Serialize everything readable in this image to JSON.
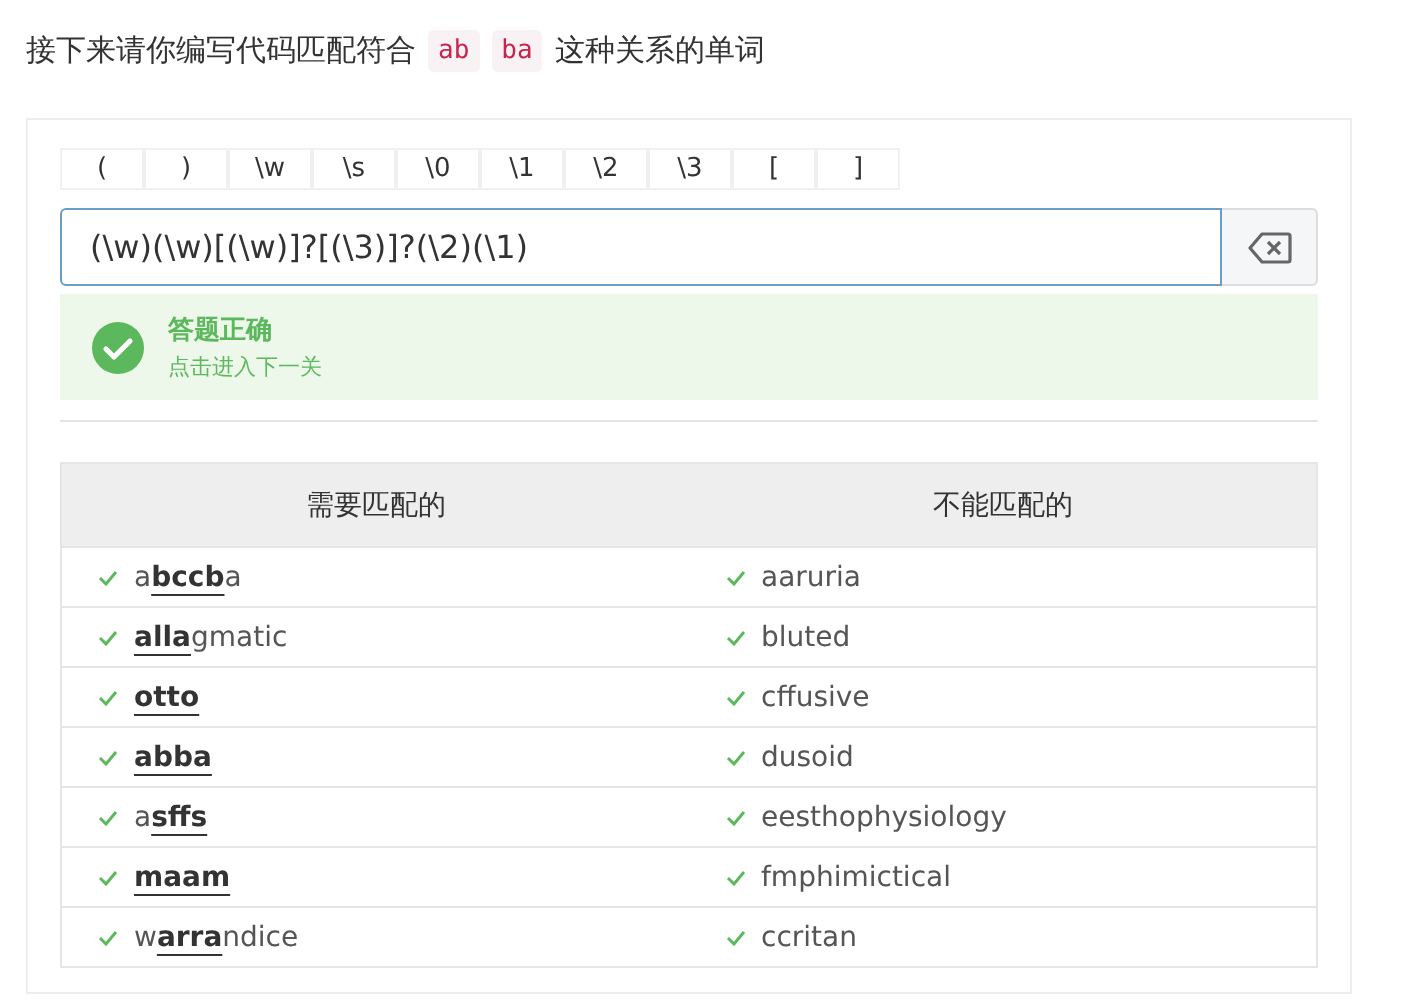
{
  "prompt": {
    "before": "接下来请你编写代码匹配符合",
    "codes": [
      "ab",
      "ba"
    ],
    "after": "这种关系的单词"
  },
  "tokens": [
    "(",
    ")",
    "\\w",
    "\\s",
    "\\0",
    "\\1",
    "\\2",
    "\\3",
    "[",
    "]"
  ],
  "regex_input": {
    "value": "(\\w)(\\w)[(\\w)]?[(\\3)]?(\\2)(\\1)"
  },
  "result": {
    "correct": true,
    "title": "答题正确",
    "subtitle": "点击进入下一关"
  },
  "table": {
    "columns": [
      "需要匹配的",
      "不能匹配的"
    ],
    "rows": [
      [
        {
          "passed": true,
          "before": "a",
          "match": "bccb",
          "after": "a"
        },
        {
          "passed": true,
          "after": "aaruria"
        }
      ],
      [
        {
          "passed": true,
          "match": "alla",
          "after": "gmatic"
        },
        {
          "passed": true,
          "after": "bluted"
        }
      ],
      [
        {
          "passed": true,
          "match": "otto"
        },
        {
          "passed": true,
          "after": "cffusive"
        }
      ],
      [
        {
          "passed": true,
          "match": "abba"
        },
        {
          "passed": true,
          "after": "dusoid"
        }
      ],
      [
        {
          "passed": true,
          "before": "a",
          "match": "sffs"
        },
        {
          "passed": true,
          "after": "eesthophysiology"
        }
      ],
      [
        {
          "passed": true,
          "match": "maam"
        },
        {
          "passed": true,
          "after": "fmphimictical"
        }
      ],
      [
        {
          "passed": true,
          "before": "w",
          "match": "arra",
          "after": "ndice"
        },
        {
          "passed": true,
          "after": "ccritan"
        }
      ]
    ]
  }
}
